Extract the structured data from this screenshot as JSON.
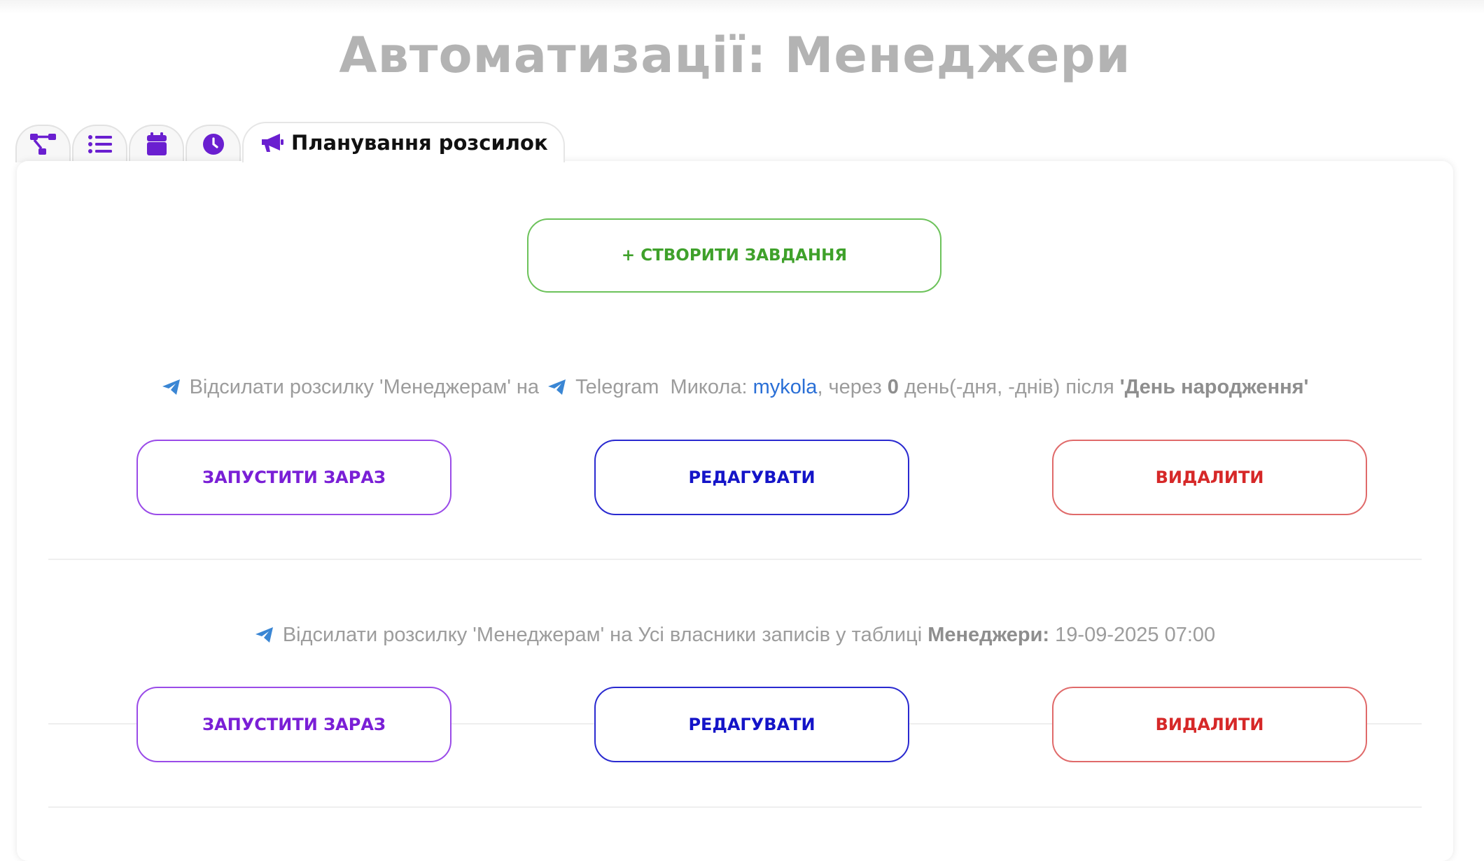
{
  "page": {
    "title": "Автоматизації: Менеджери"
  },
  "tabs": [
    {
      "icon": "sitemap-icon",
      "label": ""
    },
    {
      "icon": "list-icon",
      "label": ""
    },
    {
      "icon": "calendar-icon",
      "label": ""
    },
    {
      "icon": "clock-icon",
      "label": ""
    },
    {
      "icon": "megaphone-icon",
      "label": "Планування розсилок",
      "active": true
    }
  ],
  "create_button": {
    "label": "+ СТВОРИТИ ЗАВДАННЯ"
  },
  "tasks": [
    {
      "prefix": "Відсилати розсилку 'Менеджерам' на",
      "channel": "Telegram",
      "recipient_label": "Микола:",
      "recipient_value": "mykola",
      "after_prefix": ", через",
      "days": "0",
      "days_suffix": "день(-дня, -днів) після",
      "event": "'День народження'"
    },
    {
      "prefix": "Відсилати розсилку 'Менеджерам' на Усі власники записів у таблиці",
      "table": "Менеджери:",
      "datetime": "19-09-2025 07:00"
    }
  ],
  "buttons": {
    "run": "ЗАПУСТИТИ ЗАРАЗ",
    "edit": "РЕДАГУВАТИ",
    "delete": "ВИДАЛИТИ"
  },
  "colors": {
    "accent_purple": "#6a1fd0",
    "create_green": "#3fa12b",
    "edit_blue": "#1414c8",
    "delete_red": "#d62828",
    "telegram_blue": "#3a86d4"
  }
}
